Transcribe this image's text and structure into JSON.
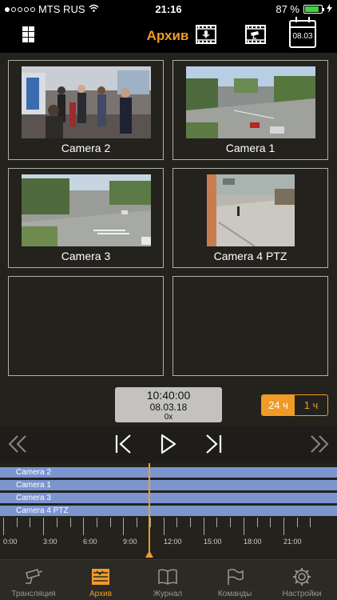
{
  "status": {
    "carrier": "MTS RUS",
    "time": "21:16",
    "battery": "87 %",
    "battery_level": 0.87
  },
  "header": {
    "title": "Архив",
    "calendar_date": "08.03"
  },
  "cameras": [
    {
      "label": "Camera 2"
    },
    {
      "label": "Camera 1"
    },
    {
      "label": "Camera 3"
    },
    {
      "label": "Camera 4 PTZ"
    }
  ],
  "playback": {
    "time": "10:40:00",
    "date": "08.03.18",
    "speed": "0x"
  },
  "range": {
    "day": "24 ч",
    "hour": "1 ч"
  },
  "timeline": {
    "tracks": [
      "Camera 2",
      "Camera 1",
      "Camera 3",
      "Camera 4 PTZ"
    ],
    "labels": [
      "0:00",
      "3:00",
      "6:00",
      "9:00",
      "12:00",
      "15:00",
      "18:00",
      "21:00"
    ]
  },
  "tabs": [
    {
      "label": "Трансляция",
      "icon": "camera-icon"
    },
    {
      "label": "Архив",
      "icon": "archive-icon"
    },
    {
      "label": "Журнал",
      "icon": "book-icon"
    },
    {
      "label": "Команды",
      "icon": "flag-icon"
    },
    {
      "label": "Настройки",
      "icon": "gear-icon"
    }
  ],
  "colors": {
    "accent": "#f19b26",
    "track": "#7c95cf",
    "background": "#23221d"
  }
}
